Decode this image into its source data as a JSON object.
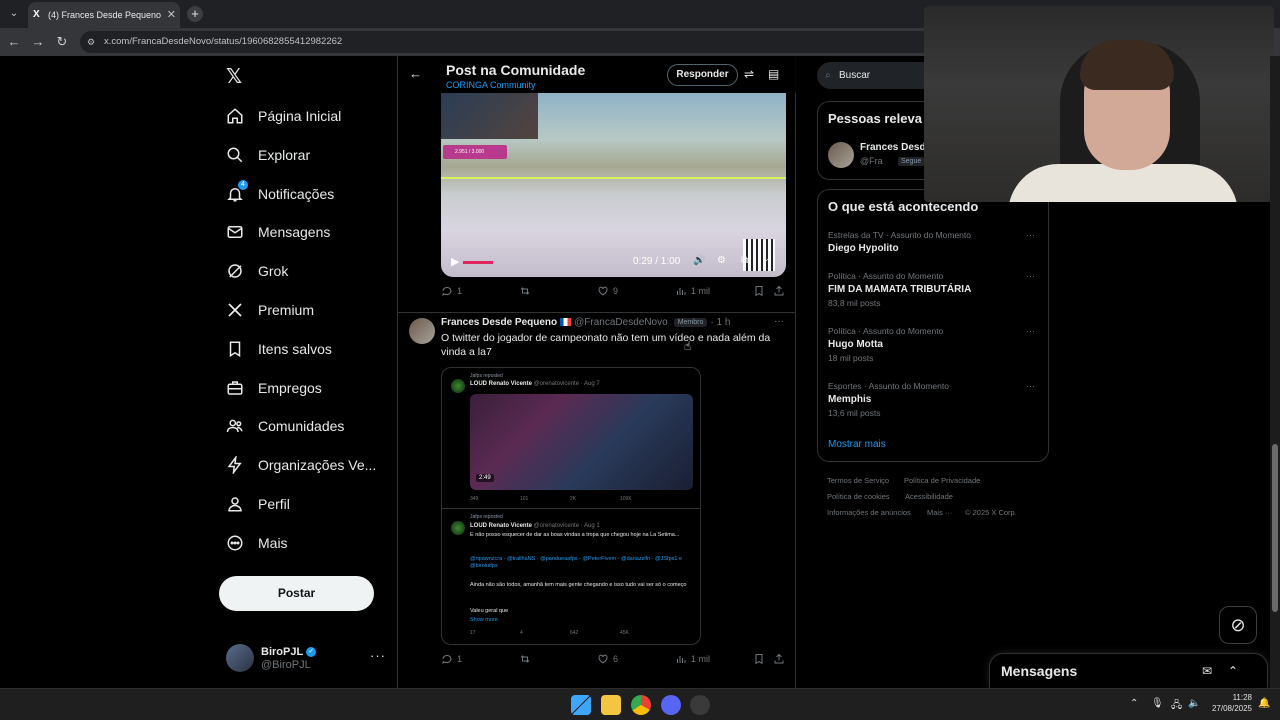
{
  "browser": {
    "tab_title": "(4) Frances Desde Pequeno",
    "url": "x.com/FrancaDesdeNovo/status/1960682855412982262"
  },
  "nav": {
    "items": [
      {
        "label": "Página Inicial",
        "icon": "home-icon"
      },
      {
        "label": "Explorar",
        "icon": "search-icon"
      },
      {
        "label": "Notificações",
        "icon": "bell-icon",
        "badge": "4"
      },
      {
        "label": "Mensagens",
        "icon": "envelope-icon"
      },
      {
        "label": "Grok",
        "icon": "grok-icon"
      },
      {
        "label": "Premium",
        "icon": "x-icon"
      },
      {
        "label": "Itens salvos",
        "icon": "bookmark-icon"
      },
      {
        "label": "Empregos",
        "icon": "briefcase-icon"
      },
      {
        "label": "Comunidades",
        "icon": "people-icon"
      },
      {
        "label": "Organizações Ve...",
        "icon": "lightning-icon"
      },
      {
        "label": "Perfil",
        "icon": "person-icon"
      },
      {
        "label": "Mais",
        "icon": "more-circle-icon"
      }
    ],
    "post_button": "Postar",
    "account": {
      "name": "BiroPJL",
      "handle": "@BiroPJL"
    }
  },
  "header": {
    "title": "Post na Comunidade",
    "community": "CORINGA Community",
    "reply_button": "Responder"
  },
  "video": {
    "time": "0:29 / 1:00",
    "follow_badge": "2.951 / 3.000"
  },
  "post1_actions": {
    "replies": "1",
    "likes": "9",
    "views": "1 mil"
  },
  "tweet": {
    "name": "Frances Desde Pequeno",
    "handle": "@FrancaDesdeNovo",
    "role": "Membro",
    "time": "· 1 h",
    "text": "O twitter do jogador de campeonato não tem um vídeo e nada além da vinda a la7",
    "actions": {
      "replies": "1",
      "likes": "6",
      "views": "1 mil"
    }
  },
  "embed": {
    "repost_label": "Jafps reposted",
    "post1": {
      "name": "LOUD Renato Vicente",
      "handle": "@orenatovicente · Aug 7",
      "duration": "2:49",
      "replies": "349",
      "reposts": "101",
      "likes": "2K",
      "views": "109K"
    },
    "repost_label2": "Jafps reposted",
    "post2": {
      "name": "LOUD Renato Vicente",
      "handle": "@orenatovicente · Aug 1",
      "line1": "E não posso esquecer de dar as boas vindas a tropa que chegou hoje na La Setima...",
      "mentions": "@npawnzcra - @trallhaNS - @pandueaafps - @PeterFivem - @dariazzifn - @JSfps1 e @biroluifps",
      "line2": "Ainda não são todos, amanhã tem mais gente chegando e isso tudo vai ser só o começo",
      "line3": "Valeu geral que",
      "show_more": "Show more",
      "replies": "17",
      "reposts": "4",
      "likes": "642",
      "views": "45K"
    }
  },
  "sidebar": {
    "search_placeholder": "Buscar",
    "relevant_title": "Pessoas releva",
    "relevant_person": {
      "name": "Frances Desde",
      "handle": "@Fra",
      "follows": "Segue"
    },
    "trends_title": "O que está acontecendo",
    "trends": [
      {
        "context": "Estrelas da TV · Assunto do Momento",
        "name": "Diego Hypolito",
        "count": ""
      },
      {
        "context": "Política · Assunto do Momento",
        "name": "FIM DA MAMATA TRIBUTÁRIA",
        "count": "83,8 mil posts"
      },
      {
        "context": "Política · Assunto do Momento",
        "name": "Hugo Motta",
        "count": "18 mil posts"
      },
      {
        "context": "Esportes · Assunto do Momento",
        "name": "Memphis",
        "count": "13,6 mil posts"
      }
    ],
    "show_more": "Mostrar mais",
    "footer": {
      "terms": "Termos de Serviço",
      "privacy": "Política de Privacidade",
      "cookies": "Política de cookies",
      "accessibility": "Acessibilidade",
      "ads": "Informações de anúncios",
      "more": "Mais ···",
      "copyright": "© 2025 X Corp."
    }
  },
  "messages_dock": {
    "title": "Mensagens"
  },
  "taskbar": {
    "time": "11:28",
    "date": "27/08/2025"
  }
}
